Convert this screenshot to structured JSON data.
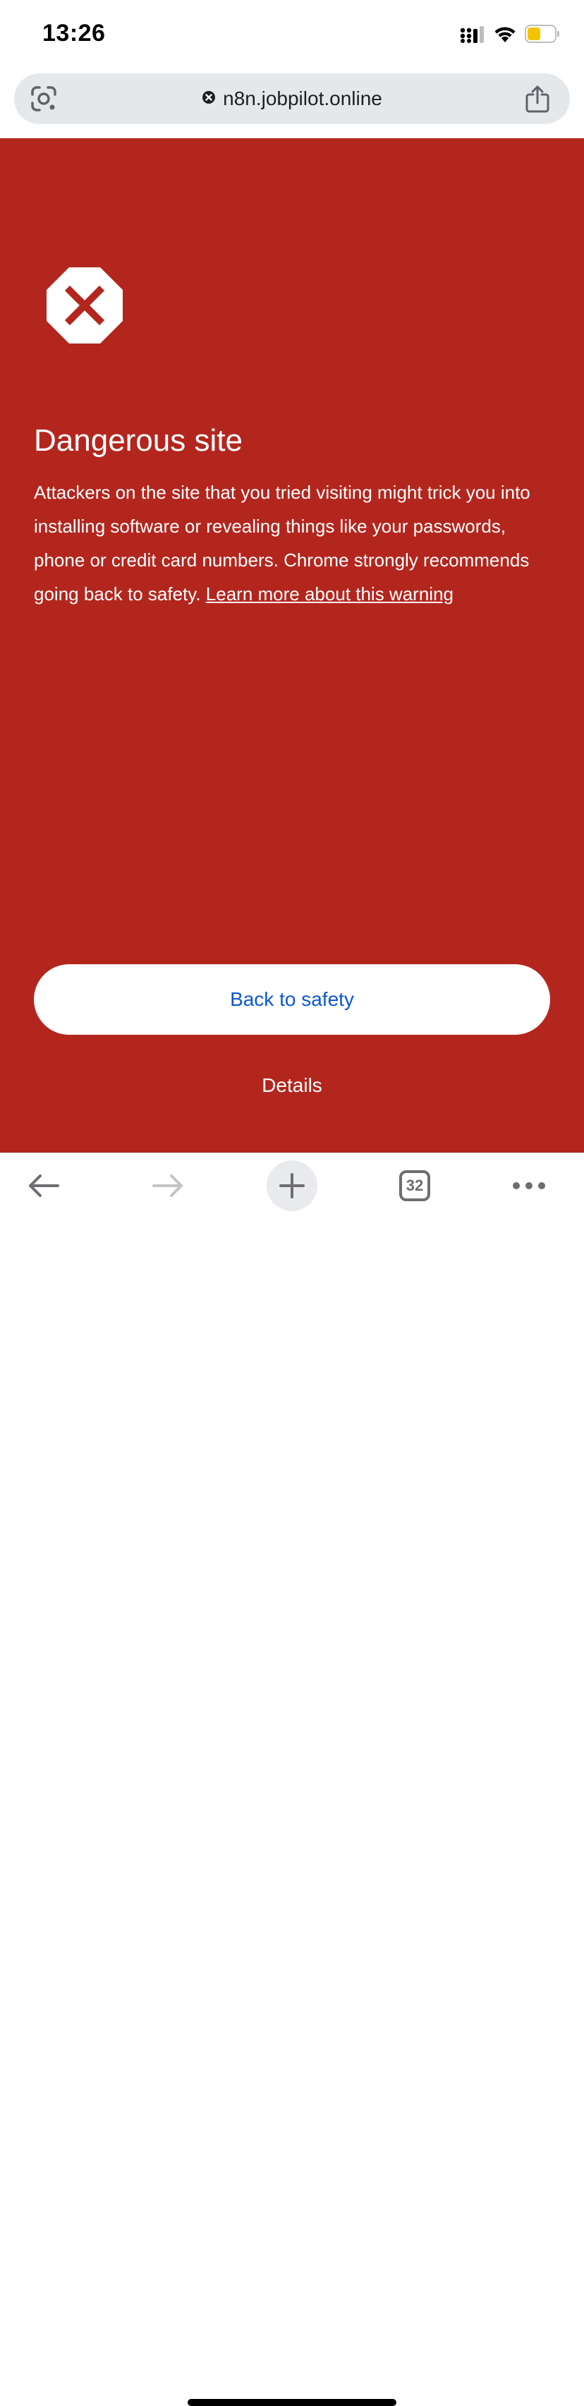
{
  "status_bar": {
    "time": "13:26",
    "icons": [
      "cellular-signal-icon",
      "wifi-icon",
      "battery-icon"
    ],
    "battery_color": "#f5c400"
  },
  "url_bar": {
    "url": "n8n.jobpilot.online",
    "icons": [
      "google-lens-icon",
      "dangerous-site-icon",
      "share-icon"
    ]
  },
  "interstitial": {
    "background_color": "#b3261e",
    "icon": "dangerous-octagon-icon",
    "title": "Dangerous site",
    "body": "Attackers on the site that you tried visiting might trick you into installing software or revealing things like your passwords, phone or credit card numbers. Chrome strongly recommends going back to safety. ",
    "learn_more_link": "Learn more about this warning",
    "back_button": "Back to safety",
    "details_button": "Details"
  },
  "toolbar": {
    "tab_count": "32",
    "icons": [
      "back-arrow-icon",
      "forward-arrow-icon",
      "new-tab-plus-icon",
      "tab-switcher-icon",
      "more-dots-icon"
    ]
  }
}
